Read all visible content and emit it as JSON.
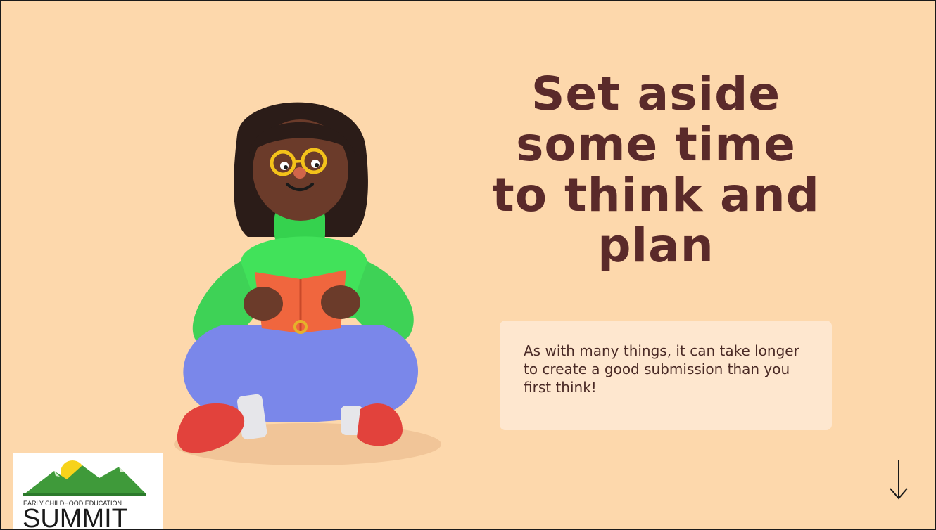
{
  "slide": {
    "title_lines": [
      "Set aside",
      "some time",
      "to think and",
      "plan"
    ],
    "callout_text": "As with many things, it can take longer to create a good submission than you first think!",
    "next_icon": "arrow-down-icon"
  },
  "logo": {
    "caption": "Early Childhood Education",
    "wordmark": "SUMMIT"
  },
  "illustration": {
    "subject": "person-reading-book-illustration"
  },
  "colors": {
    "background": "#fdd8ac",
    "title": "#5a2a2a",
    "callout_bg": "#fee7cf",
    "callout_text": "#4a2a26",
    "sweater": "#3fe35a",
    "pants": "#7b87e8",
    "book": "#f0643c",
    "shoes": "#e0403c",
    "sun": "#f7d31b",
    "mountains": "#3f9a3a"
  }
}
